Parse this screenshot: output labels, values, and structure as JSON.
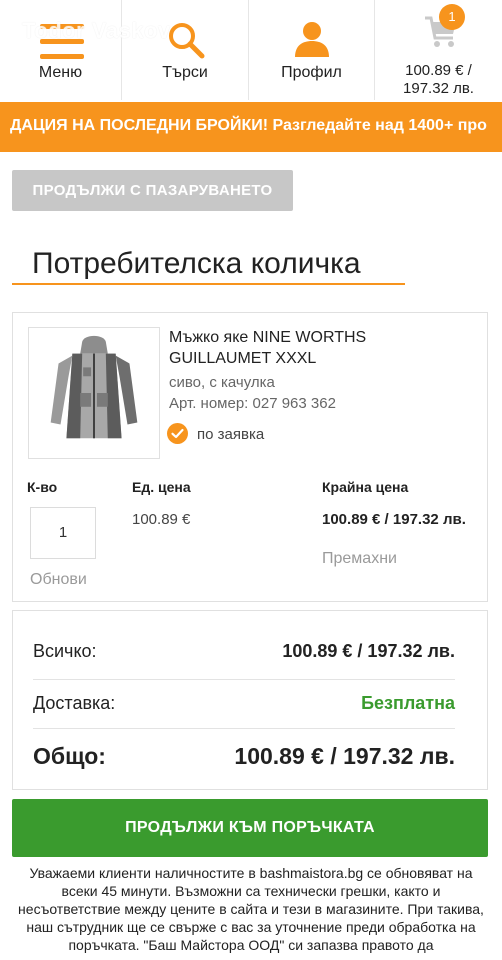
{
  "watermark": "Todor Vaskov",
  "header": {
    "menu_label": "Меню",
    "search_label": "Търси",
    "profile_label": "Профил",
    "cart_count": "1",
    "cart_price_line1": "100.89 € /",
    "cart_price_line2": "197.32 лв.",
    "accent_color": "#f7941d",
    "icons": [
      "menu-icon",
      "search-icon",
      "user-icon",
      "cart-icon"
    ]
  },
  "promo": {
    "text": "ДАЦИЯ НА ПОСЛЕДНИ БРОЙКИ! Разгледайте над 1400+ про"
  },
  "continue_shopping_label": "ПРОДЪЛЖИ С ПАЗАРУВАНЕТО",
  "page_title": "Потребителска количка",
  "item": {
    "name": "Мъжко яке NINE WORTHS GUILLAUMET XXXL",
    "variant": "сиво, с качулка",
    "sku": "Арт. номер: 027 963 362",
    "availability": "по заявка",
    "headers": {
      "qty": "К-во",
      "unit_price": "Ед. цена",
      "final_price": "Крайна цена"
    },
    "qty": "1",
    "refresh_label": "Обнови",
    "unit_price": "100.89 €",
    "final_price": "100.89 € / 197.32 лв.",
    "remove_label": "Премахни"
  },
  "totals": {
    "subtotal_label": "Всичко:",
    "subtotal_value": "100.89 € / 197.32 лв.",
    "shipping_label": "Доставка:",
    "shipping_value": "Безплатна",
    "total_label": "Общо:",
    "total_value": "100.89 € / 197.32 лв."
  },
  "checkout_label": "ПРОДЪЛЖИ КЪМ ПОРЪЧКАТА",
  "notice": "Уважаеми клиенти наличностите в bashmaistora.bg се обновяват на всеки 45 минути. Възможни са технически грешки, както и несъответствие между цените в сайта и тези в магазините. При такива, наш сътрудник ще се свърже с вас за уточнение преди обработка на поръчката. \"Баш Майстора ООД\" си запазва правото да",
  "colors": {
    "accent": "#f7941d",
    "green": "#3a9b2e",
    "disabled_button": "#c7c7c7"
  }
}
